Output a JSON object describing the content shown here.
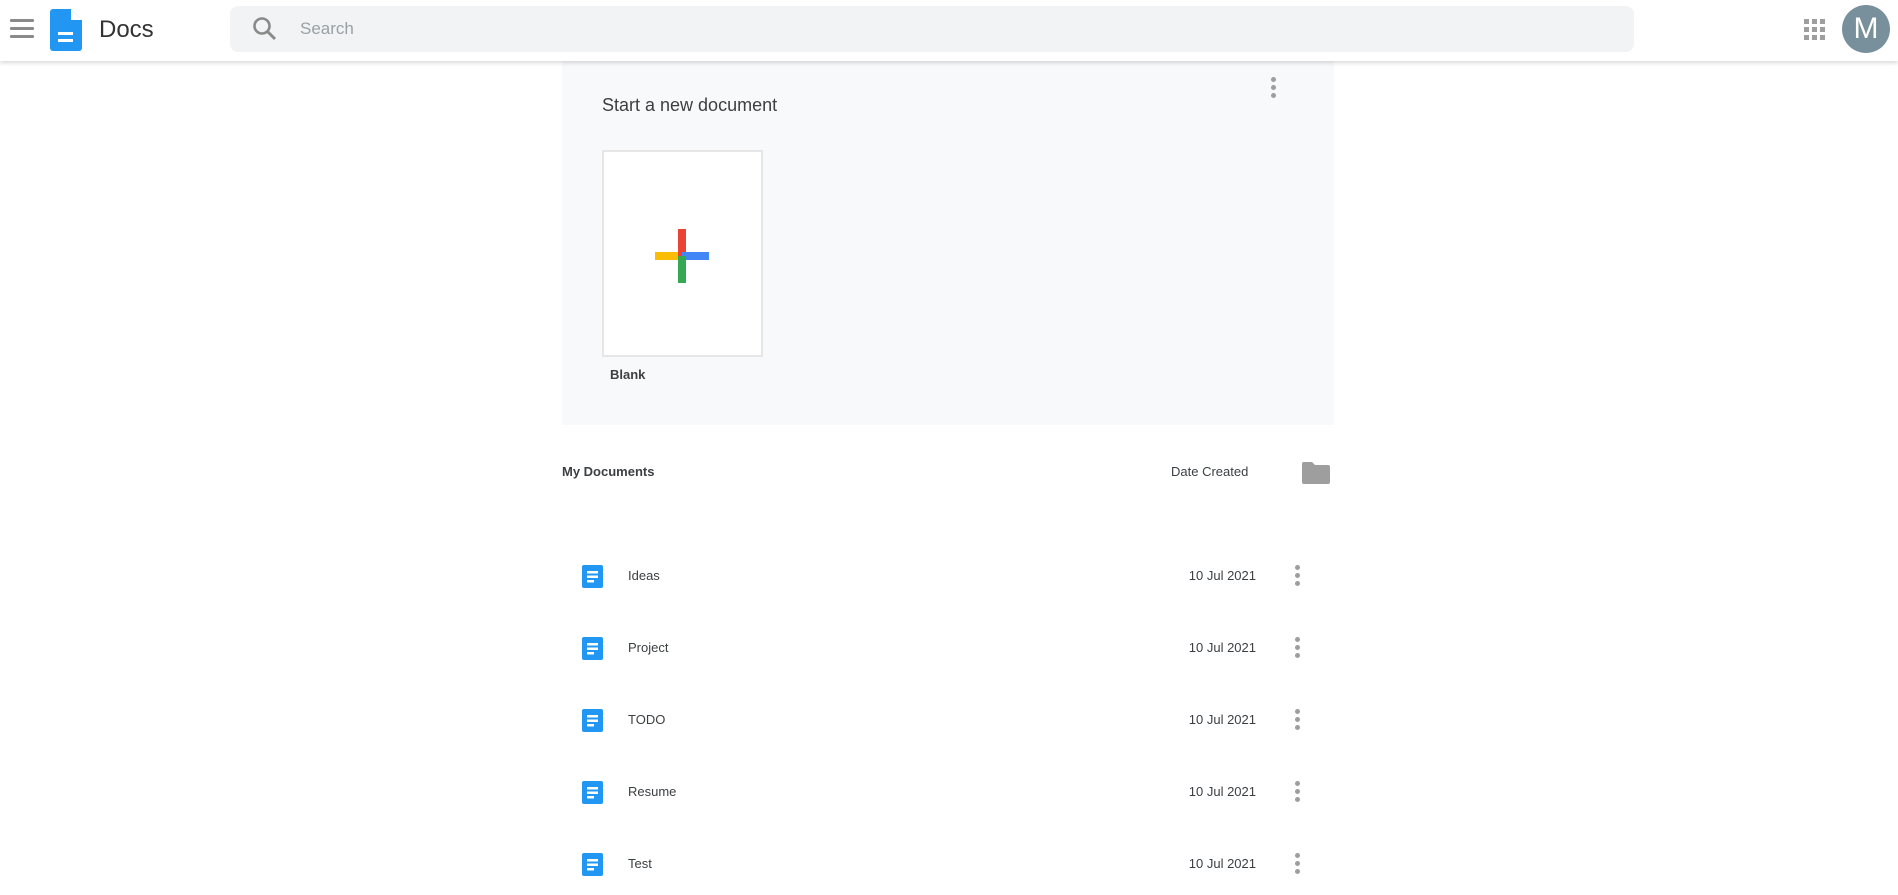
{
  "header": {
    "app_title": "Docs",
    "search_placeholder": "Search",
    "avatar_letter": "M"
  },
  "new_doc": {
    "title": "Start a new document",
    "templates": [
      {
        "label": "Blank"
      }
    ]
  },
  "documents": {
    "title": "My Documents",
    "sort_label": "Date Created",
    "items": [
      {
        "name": "Ideas",
        "date": "10 Jul 2021"
      },
      {
        "name": "Project",
        "date": "10 Jul 2021"
      },
      {
        "name": "TODO",
        "date": "10 Jul 2021"
      },
      {
        "name": "Resume",
        "date": "10 Jul 2021"
      },
      {
        "name": "Test",
        "date": "10 Jul 2021"
      }
    ]
  },
  "colors": {
    "accent": "#2196f3",
    "avatar": "#78909c",
    "panel": "#f8f9fa"
  }
}
